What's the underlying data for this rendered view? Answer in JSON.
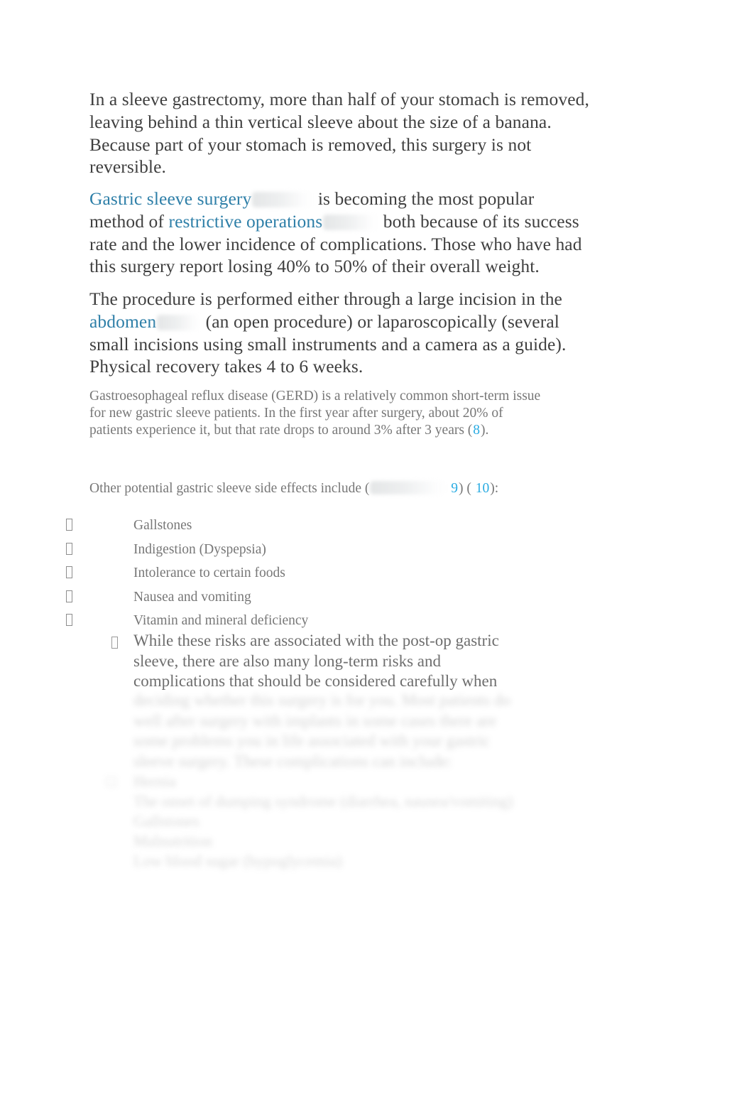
{
  "document": {
    "background_color": "#ffffff",
    "body_text_color": "#3f3f3f",
    "secondary_text_color": "#777777",
    "link_color": "#2e7fa8",
    "reference_link_color": "#29abe2"
  },
  "paragraphs": {
    "p1": "In a sleeve gastrectomy, more than half of your stomach is removed, leaving behind a thin vertical sleeve about the size of a banana. Because part of your stomach is removed, this surgery is not reversible.",
    "p2": {
      "link1": "Gastric sleeve surgery",
      "mid1": "is becoming the most popular method of",
      "link2": "restrictive operations",
      "mid2": "both because of its success rate and the lower incidence of complications. Those who have had this surgery report losing 40% to 50% of their overall weight."
    },
    "p3": {
      "pre": "The procedure is performed either through a large incision in the",
      "link": "abdomen",
      "post": "(an open procedure) or laparoscopically (several small incisions using small instruments and a camera as a guide). Physical recovery takes 4 to 6 weeks."
    },
    "p4": {
      "text": "Gastroesophageal reflux disease (GERD) is a relatively common short-term issue for new gastric sleeve patients. In the first year after surgery, about 20% of patients experience it, but that rate drops to around 3% after 3 years (",
      "ref": "8",
      "tail": ")."
    },
    "p5": {
      "lead": "Other potential gastric sleeve side effects include (",
      "ref1": "9",
      "between": ") (",
      "ref2": "10",
      "tail": "):"
    }
  },
  "side_effects_list": {
    "bullet_glyph": "missing-glyph-box",
    "items": [
      "Gallstones",
      "Indigestion (Dyspepsia)",
      "Intolerance to certain foods",
      "Nausea and vomiting",
      "Vitamin and mineral deficiency"
    ]
  },
  "sub_note": {
    "bullet_glyph": "missing-glyph-box",
    "visible_text": "While these risks are associated with the post-op gastric sleeve, there are also many long-term risks and complications that should be considered carefully when"
  },
  "blurred_region": {
    "note": "text is blurred/illegible in the screenshot",
    "paragraph_lines": [
      "deciding whether this surgery is for you. Most patients do",
      "well after surgery with implants  in some cases there are",
      "some problems you  in life associated with your gastric",
      "sleeve surgery.  These complications can include:"
    ],
    "list_lines": [
      "Hernia",
      "The onset of dumping syndrome (diarrhea, nausea/vomiting)",
      "Gallstones",
      "Malnutrition",
      "Low blood sugar (hypoglycemia)"
    ]
  }
}
